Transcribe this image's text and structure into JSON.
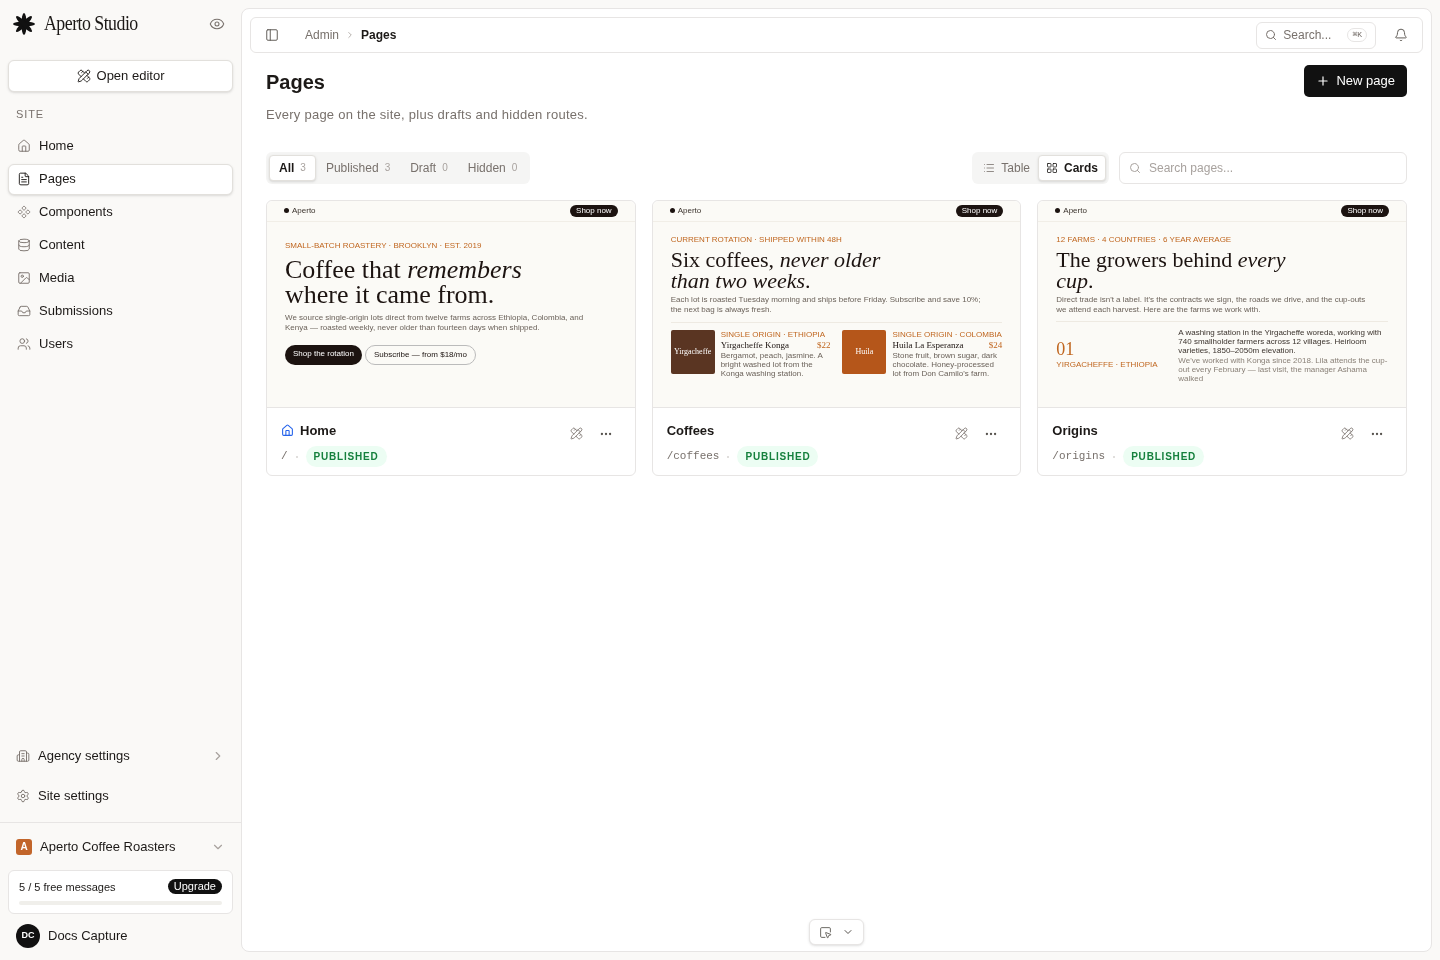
{
  "brand": {
    "name": "Aperto Studio"
  },
  "sidebar": {
    "open_editor": "Open editor",
    "section": "SITE",
    "items": [
      {
        "label": "Home",
        "selected": false
      },
      {
        "label": "Pages",
        "selected": true
      },
      {
        "label": "Components",
        "selected": false
      },
      {
        "label": "Content",
        "selected": false
      },
      {
        "label": "Media",
        "selected": false
      },
      {
        "label": "Submissions",
        "selected": false
      },
      {
        "label": "Users",
        "selected": false
      }
    ],
    "bottom_items": [
      {
        "label": "Agency settings",
        "chevron": true
      },
      {
        "label": "Site settings",
        "chevron": false
      }
    ]
  },
  "workspace": {
    "initial": "A",
    "name": "Aperto Coffee Roasters"
  },
  "usage": {
    "text": "5 / 5 free messages",
    "button": "Upgrade",
    "level": 0
  },
  "user": {
    "initials": "DC",
    "name": "Docs Capture"
  },
  "breadcrumb": [
    "Admin",
    "Pages"
  ],
  "search": {
    "placeholder": "Search...",
    "shortcut": "⌘K"
  },
  "page": {
    "title": "Pages",
    "subtitle": "Every page on the site, plus drafts and hidden routes.",
    "new_button": "New page"
  },
  "filters": [
    {
      "label": "All",
      "count": "3",
      "selected": true
    },
    {
      "label": "Published",
      "count": "3",
      "selected": false
    },
    {
      "label": "Draft",
      "count": "0",
      "selected": false
    },
    {
      "label": "Hidden",
      "count": "0",
      "selected": false
    }
  ],
  "views": [
    {
      "label": "Table",
      "selected": false
    },
    {
      "label": "Cards",
      "selected": true
    }
  ],
  "page_search": {
    "placeholder": "Search pages..."
  },
  "cards": [
    {
      "title": "Home",
      "is_home": true,
      "path": "/",
      "status": "PUBLISHED",
      "preview": {
        "brand": "Aperto",
        "nav_button": "Shop now",
        "kicker": "SMALL-BATCH ROASTERY · BROOKLYN · EST. 2019",
        "headline": "Coffee that *remembers* where it came from.",
        "body": "We source single-origin lots direct from twelve farms across Ethiopia, Colombia, and Kenya — roasted weekly, never older than fourteen days when shipped.",
        "section": {
          "kind": "buttons",
          "primary": "Shop the rotation",
          "secondary": "Subscribe — from $18/mo"
        }
      }
    },
    {
      "title": "Coffees",
      "is_home": false,
      "path": "/coffees",
      "status": "PUBLISHED",
      "preview": {
        "brand": "Aperto",
        "nav_button": "Shop now",
        "kicker": "CURRENT ROTATION · SHIPPED WITHIN 48H",
        "headline": "Six coffees, *never older than two weeks*.",
        "body": "Each lot is roasted Tuesday morning and ships before Friday. Subscribe and save 10%; the next bag is always fresh.",
        "section": {
          "kind": "products",
          "items": [
            {
              "image_label": "Yirgacheffe",
              "color": "#5a3522",
              "kicker": "SINGLE ORIGIN · ETHIOPIA",
              "name": "Yirgacheffe Konga",
              "price": "$22",
              "text": "Bergamot, peach, jasmine. A bright washed lot from the Konga washing station."
            },
            {
              "image_label": "Huila",
              "color": "#b5561a",
              "kicker": "SINGLE ORIGIN · COLOMBIA",
              "name": "Huila La Esperanza",
              "price": "$24",
              "text": "Stone fruit, brown sugar, dark chocolate. Honey-processed lot from Don Camilo's farm."
            }
          ]
        }
      }
    },
    {
      "title": "Origins",
      "is_home": false,
      "path": "/origins",
      "status": "PUBLISHED",
      "preview": {
        "brand": "Aperto",
        "nav_button": "Shop now",
        "kicker": "12 FARMS · 4 COUNTRIES · 6 YEAR AVERAGE",
        "headline": "The growers behind *every cup*.",
        "body": "Direct trade isn't a label. It's the contracts we sign, the roads we drive, and the cup-outs we attend each harvest. Here are the farms we work with.",
        "section": {
          "kind": "origin",
          "number": "01",
          "kicker": "YIRGACHEFFE · ETHIOPIA",
          "text": "A washing station in the Yirgacheffe woreda, working with 740 smallholder farmers across 12 villages. Heirloom varieties, 1850–2050m elevation.",
          "note": "We've worked with Konga since 2018. Lila attends the cup-out every February — last visit, the manager Ashama walked"
        }
      }
    }
  ]
}
